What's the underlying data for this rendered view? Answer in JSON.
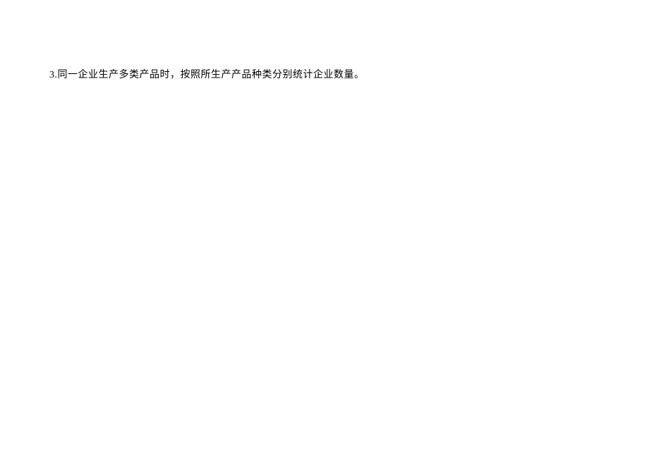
{
  "document": {
    "note_text": "3.同一企业生产多类产品时，按照所生产产品种类分别统计企业数量。"
  }
}
